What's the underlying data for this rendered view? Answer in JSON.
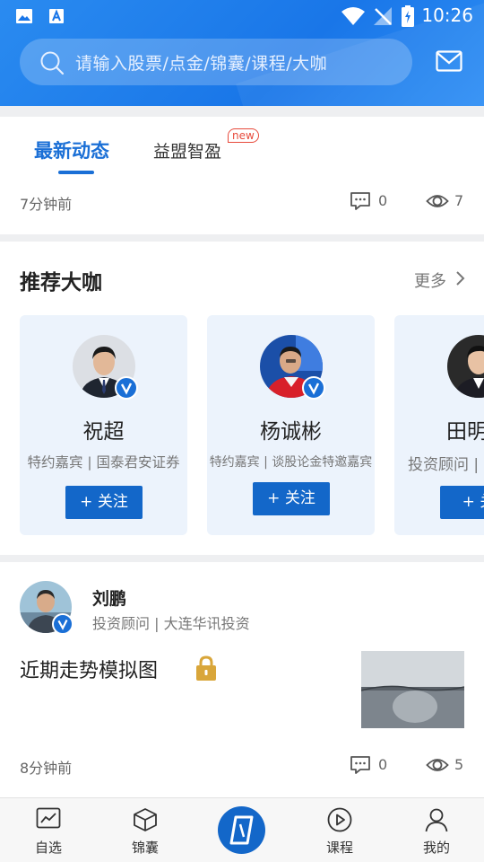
{
  "status_bar": {
    "time": "10:26"
  },
  "search": {
    "placeholder": "请输入股票/点金/锦囊/课程/大咖"
  },
  "tabs": [
    {
      "label": "最新动态",
      "active": true
    },
    {
      "label": "益盟智盈",
      "badge": "new"
    }
  ],
  "feed_item_top": {
    "time": "7分钟前",
    "comments": "0",
    "views": "7"
  },
  "recommend": {
    "title": "推荐大咖",
    "more_label": "更多",
    "experts": [
      {
        "name": "祝超",
        "desc": "特约嘉宾 | 国泰君安证券",
        "follow": "+ 关注"
      },
      {
        "name": "杨诚彬",
        "desc": "特约嘉宾 | 谈股论金特邀嘉宾",
        "follow": "+ 关注"
      },
      {
        "name": "田明",
        "desc": "投资顾问 |",
        "follow": "+ 关"
      }
    ]
  },
  "post": {
    "author": "刘鹏",
    "author_desc": "投资顾问 | 大连华讯投资",
    "title": "近期走势模拟图",
    "time": "8分钟前",
    "comments": "0",
    "views": "5"
  },
  "bottom_nav": [
    {
      "label": "自选",
      "icon": "chart-icon"
    },
    {
      "label": "锦囊",
      "icon": "cube-icon"
    },
    {
      "label": "",
      "icon": "app-logo-icon"
    },
    {
      "label": "课程",
      "icon": "play-icon"
    },
    {
      "label": "我的",
      "icon": "user-icon"
    }
  ],
  "colors": {
    "primary": "#1a6fd6",
    "header": "#1976e8",
    "card_bg": "#ecf3fc",
    "badge": "#e74a3b",
    "lock": "#d9a63a"
  }
}
